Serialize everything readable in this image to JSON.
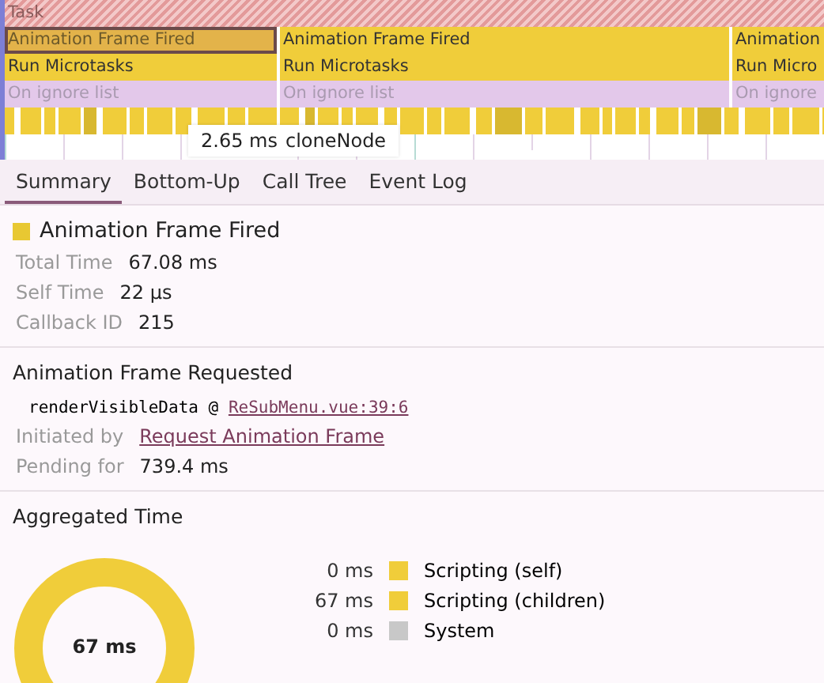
{
  "flame_chart": {
    "tracks": [
      {
        "kind": "task",
        "segments": [
          {
            "label": "Task",
            "selected": false
          }
        ]
      },
      {
        "kind": "event",
        "segments": [
          {
            "label": "Animation Frame Fired",
            "selected": true
          },
          {
            "label": "Animation Frame Fired",
            "selected": false
          },
          {
            "label": "Animation",
            "selected": false
          }
        ]
      },
      {
        "kind": "event",
        "segments": [
          {
            "label": "Run Microtasks",
            "selected": false
          },
          {
            "label": "Run Microtasks",
            "selected": false
          },
          {
            "label": "Run Micro",
            "selected": false
          }
        ]
      },
      {
        "kind": "ignored",
        "segments": [
          {
            "label": "On ignore list",
            "selected": false
          },
          {
            "label": "On ignore list",
            "selected": false
          },
          {
            "label": "On ignore",
            "selected": false
          }
        ]
      }
    ],
    "tooltip": {
      "duration": "2.65 ms",
      "name": "cloneNode"
    }
  },
  "tabs": [
    {
      "label": "Summary",
      "selected": true
    },
    {
      "label": "Bottom-Up",
      "selected": false
    },
    {
      "label": "Call Tree",
      "selected": false
    },
    {
      "label": "Event Log",
      "selected": false
    }
  ],
  "summary": {
    "title": "Animation Frame Fired",
    "color": "#e8c832",
    "fields": [
      {
        "label": "Total Time",
        "value": "67.08 ms"
      },
      {
        "label": "Self Time",
        "value": "22 μs"
      },
      {
        "label": "Callback ID",
        "value": "215"
      }
    ]
  },
  "requested": {
    "title": "Animation Frame Requested",
    "stack": {
      "function": "renderVisibleData @ ",
      "link": "ReSubMenu.vue:39:6"
    },
    "fields": [
      {
        "label": "Initiated by",
        "value": "Request Animation Frame",
        "kind": "link"
      },
      {
        "label": "Pending for",
        "value": "739.4 ms",
        "kind": "text"
      }
    ]
  },
  "aggregated": {
    "title": "Aggregated Time",
    "total": "67 ms",
    "legend": [
      {
        "value": "0 ms",
        "label": "Scripting (self)",
        "color": "#f0cd3a"
      },
      {
        "value": "67 ms",
        "label": "Scripting (children)",
        "color": "#f0cd3a"
      },
      {
        "value": "0 ms",
        "label": "System",
        "color": "#c8c8c8"
      }
    ]
  }
}
